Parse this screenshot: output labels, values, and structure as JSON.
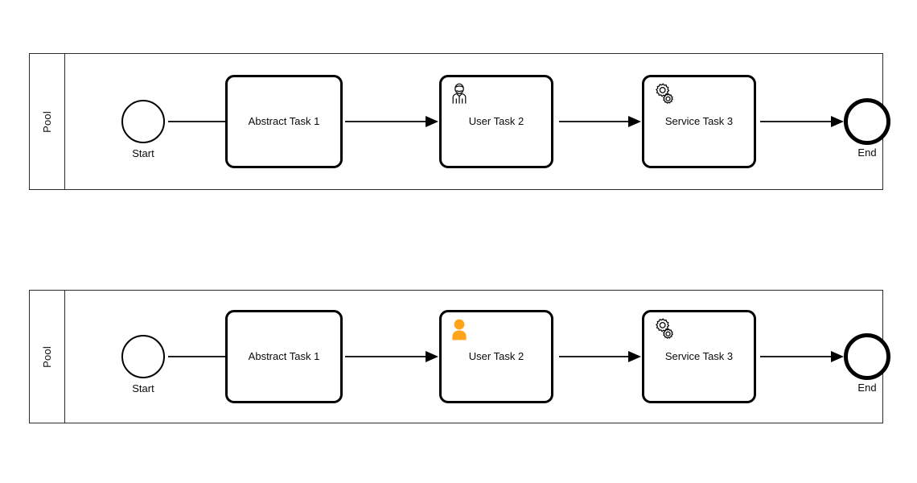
{
  "diagram": {
    "type": "bpmn-process",
    "notation": "BPMN 2.0",
    "colors": {
      "stroke": "#000000",
      "pool_border": "#2b2b2b",
      "background": "#ffffff",
      "user_icon_highlight": "#ffa41b"
    }
  },
  "pools": [
    {
      "id": "pool-top",
      "header_label": "Pool",
      "nodes": [
        {
          "id": "start",
          "kind": "start-event",
          "label": "Start",
          "label_position": "below"
        },
        {
          "id": "task1",
          "kind": "task",
          "label": "Abstract Task 1",
          "icon": "none"
        },
        {
          "id": "task2",
          "kind": "user-task",
          "label": "User Task 2",
          "icon": "user-outline-icon"
        },
        {
          "id": "task3",
          "kind": "service-task",
          "label": "Service Task 3",
          "icon": "gears-outline-icon"
        },
        {
          "id": "end",
          "kind": "end-event",
          "label": "End",
          "label_position": "below"
        }
      ]
    },
    {
      "id": "pool-bottom",
      "header_label": "Pool",
      "nodes": [
        {
          "id": "start",
          "kind": "start-event",
          "label": "Start",
          "label_position": "below"
        },
        {
          "id": "task1",
          "kind": "task",
          "label": "Abstract Task 1",
          "icon": "none"
        },
        {
          "id": "task2",
          "kind": "user-task",
          "label": "User Task 2",
          "icon": "user-solid-orange-icon"
        },
        {
          "id": "task3",
          "kind": "service-task",
          "label": "Service Task 3",
          "icon": "gears-outline-icon"
        },
        {
          "id": "end",
          "kind": "end-event",
          "label": "End",
          "label_position": "below"
        }
      ]
    }
  ]
}
